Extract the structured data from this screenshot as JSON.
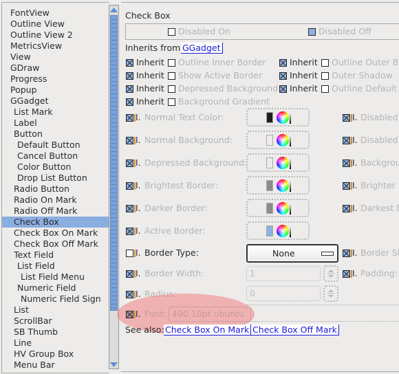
{
  "sidebar": {
    "items": [
      {
        "label": "FontView",
        "indent": 0
      },
      {
        "label": "Outline View",
        "indent": 0
      },
      {
        "label": "Outline View 2",
        "indent": 0
      },
      {
        "label": "MetricsView",
        "indent": 0
      },
      {
        "label": "View",
        "indent": 0
      },
      {
        "label": "GDraw",
        "indent": 0
      },
      {
        "label": "Progress",
        "indent": 0
      },
      {
        "label": "Popup",
        "indent": 0
      },
      {
        "label": "GGadget",
        "indent": 0
      },
      {
        "label": "List Mark",
        "indent": 1
      },
      {
        "label": "Label",
        "indent": 1
      },
      {
        "label": "Button",
        "indent": 1
      },
      {
        "label": "Default Button",
        "indent": 2
      },
      {
        "label": "Cancel Button",
        "indent": 2
      },
      {
        "label": "Color Button",
        "indent": 2
      },
      {
        "label": "Drop List Button",
        "indent": 2
      },
      {
        "label": "Radio Button",
        "indent": 1
      },
      {
        "label": "Radio On Mark",
        "indent": 1
      },
      {
        "label": "Radio Off Mark",
        "indent": 1
      },
      {
        "label": "Check Box",
        "indent": 1,
        "selected": true
      },
      {
        "label": "Check Box On Mark",
        "indent": 1
      },
      {
        "label": "Check Box Off Mark",
        "indent": 1
      },
      {
        "label": "Text Field",
        "indent": 1
      },
      {
        "label": "List Field",
        "indent": 2
      },
      {
        "label": "List Field Menu",
        "indent": 3
      },
      {
        "label": "Numeric Field",
        "indent": 2
      },
      {
        "label": "Numeric Field Sign",
        "indent": 3
      },
      {
        "label": "List",
        "indent": 1
      },
      {
        "label": "ScrollBar",
        "indent": 1
      },
      {
        "label": "SB Thumb",
        "indent": 1
      },
      {
        "label": "Line",
        "indent": 1
      },
      {
        "label": "HV Group Box",
        "indent": 1
      },
      {
        "label": "Menu Bar",
        "indent": 1
      }
    ]
  },
  "panel": {
    "title": "Check Box",
    "preview": {
      "disabled_on": "Disabled On",
      "disabled_off": "Disabled Off"
    },
    "inherits_label": "Inherits from",
    "inherits_link": "GGadget",
    "inherit_word": "Inherit",
    "flags": [
      {
        "label": "Outline Inner Border"
      },
      {
        "label": "Outline Outer Border"
      },
      {
        "label": "Show Active Border"
      },
      {
        "label": "Outer Shadow"
      },
      {
        "label": "Depressed Background"
      },
      {
        "label": "Outline Default"
      },
      {
        "label": "Background Gradient"
      }
    ],
    "i_word": "I.",
    "left_props": [
      {
        "label": "Normal Text Color:",
        "swatch": "#1e1e1e"
      },
      {
        "label": "Normal Background:",
        "swatch": "#edeceb"
      },
      {
        "label": "Depressed Background:",
        "swatch": "#edeceb"
      },
      {
        "label": "Brightest Border:",
        "swatch": "#8c8c8c"
      },
      {
        "label": "Darker Border:",
        "swatch": "#8c8c8c"
      },
      {
        "label": "Active Border:",
        "swatch": "#8ab3e0"
      }
    ],
    "right_props": [
      "Disabled",
      "Disabled",
      "Backgrou",
      "Brighter B",
      "Darkest B",
      "Border Sh",
      "Padding:"
    ],
    "border_type_label": "Border Type:",
    "border_type_value": "None",
    "border_width_label": "Border Width:",
    "border_width_value": "1",
    "radius_label": "Radius:",
    "radius_value": "0",
    "font_label": "Font:",
    "font_value": "400 10pt ubuntu",
    "see_also_label": "See also:",
    "see_also_links": [
      "Check Box On Mark",
      "Check Box Off Mark"
    ]
  }
}
